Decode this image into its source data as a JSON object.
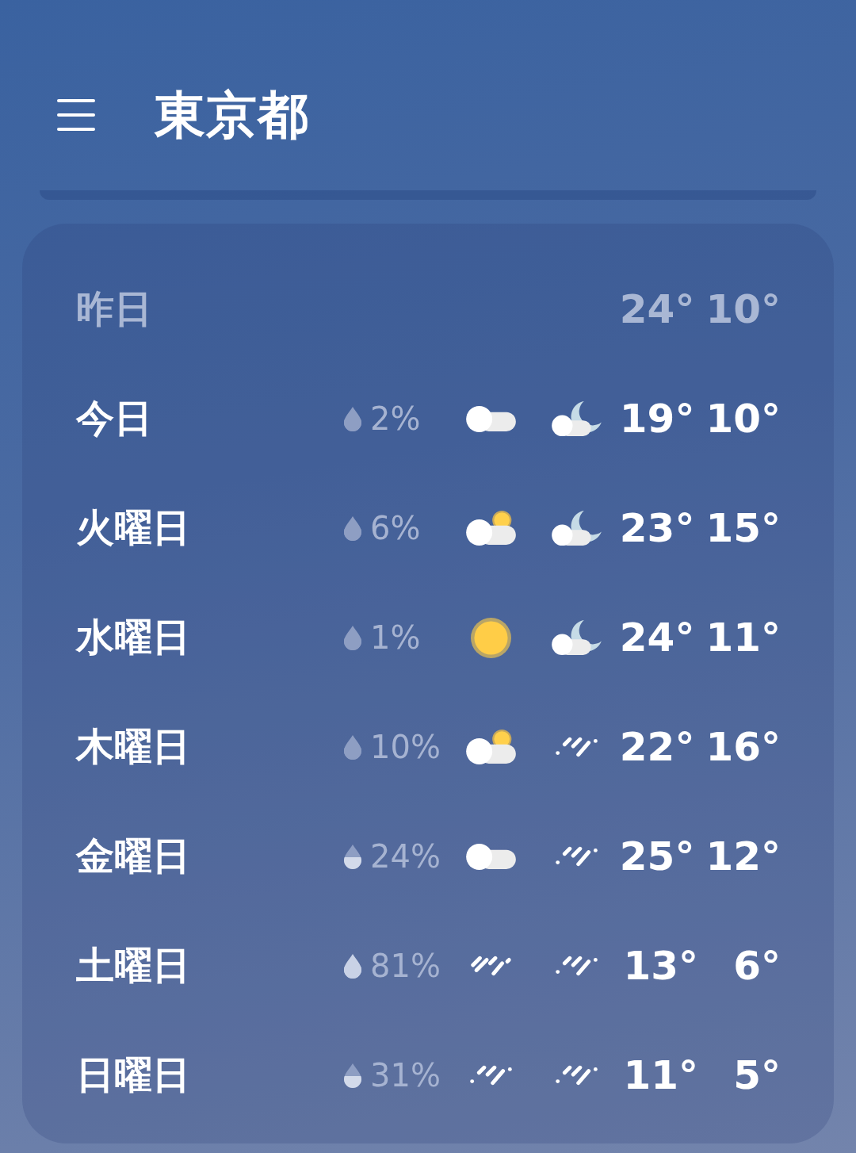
{
  "header": {
    "title": "東京都"
  },
  "days": [
    {
      "label": "昨日",
      "past": true,
      "high": "24°",
      "low": "10°"
    },
    {
      "label": "今日",
      "past": false,
      "drop": {
        "kind": "plain"
      },
      "precip": "2%",
      "day_icon": {
        "kind": "cloud"
      },
      "night_icon": {
        "kind": "moon_cloud"
      },
      "high": "19°",
      "low": "10°"
    },
    {
      "label": "火曜日",
      "past": false,
      "drop": {
        "kind": "plain"
      },
      "precip": "6%",
      "day_icon": {
        "kind": "sun_cloud"
      },
      "night_icon": {
        "kind": "moon_cloud"
      },
      "high": "23°",
      "low": "15°"
    },
    {
      "label": "水曜日",
      "past": false,
      "drop": {
        "kind": "plain"
      },
      "precip": "1%",
      "day_icon": {
        "kind": "sun"
      },
      "night_icon": {
        "kind": "moon_cloud"
      },
      "high": "24°",
      "low": "11°"
    },
    {
      "label": "木曜日",
      "past": false,
      "drop": {
        "kind": "plain"
      },
      "precip": "10%",
      "day_icon": {
        "kind": "sun_cloud"
      },
      "night_icon": {
        "kind": "rain"
      },
      "high": "22°",
      "low": "16°"
    },
    {
      "label": "金曜日",
      "past": false,
      "drop": {
        "kind": "half"
      },
      "precip": "24%",
      "day_icon": {
        "kind": "cloud"
      },
      "night_icon": {
        "kind": "rain"
      },
      "high": "25°",
      "low": "12°"
    },
    {
      "label": "土曜日",
      "past": false,
      "drop": {
        "kind": "full"
      },
      "precip": "81%",
      "day_icon": {
        "kind": "rain_heavy"
      },
      "night_icon": {
        "kind": "rain"
      },
      "high": "13°",
      "low": "6°"
    },
    {
      "label": "日曜日",
      "past": false,
      "drop": {
        "kind": "half"
      },
      "precip": "31%",
      "day_icon": {
        "kind": "rain"
      },
      "night_icon": {
        "kind": "rain"
      },
      "high": "11°",
      "low": "5°"
    }
  ]
}
